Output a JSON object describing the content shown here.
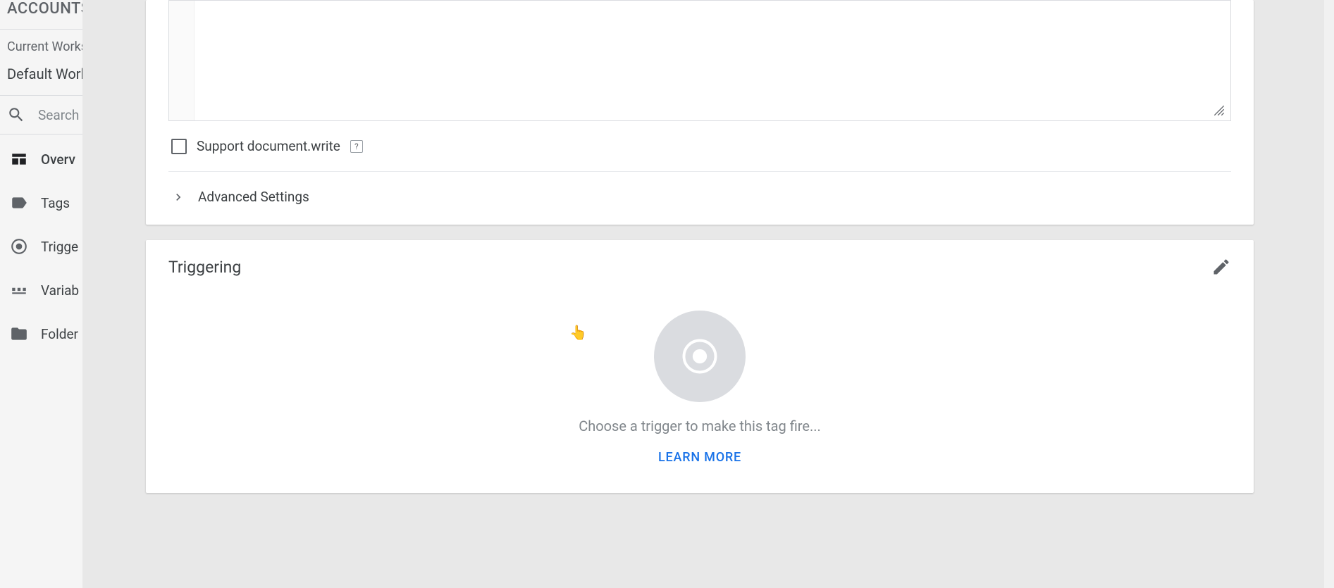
{
  "sidebar": {
    "accounts_label": "ACCOUNTS",
    "current_workspace_label": "Current Worksp",
    "workspace_name": "Default Works",
    "search_placeholder": "Search",
    "nav": {
      "overview": "Overv",
      "tags": "Tags",
      "triggers": "Trigge",
      "variables": "Variab",
      "folders": "Folder"
    }
  },
  "config": {
    "support_doc_write": "Support document.write",
    "help_symbol": "?",
    "advanced_settings": "Advanced Settings"
  },
  "trigger": {
    "title": "Triggering",
    "choose_text": "Choose a trigger to make this tag fire...",
    "learn_more": "LEARN MORE"
  }
}
